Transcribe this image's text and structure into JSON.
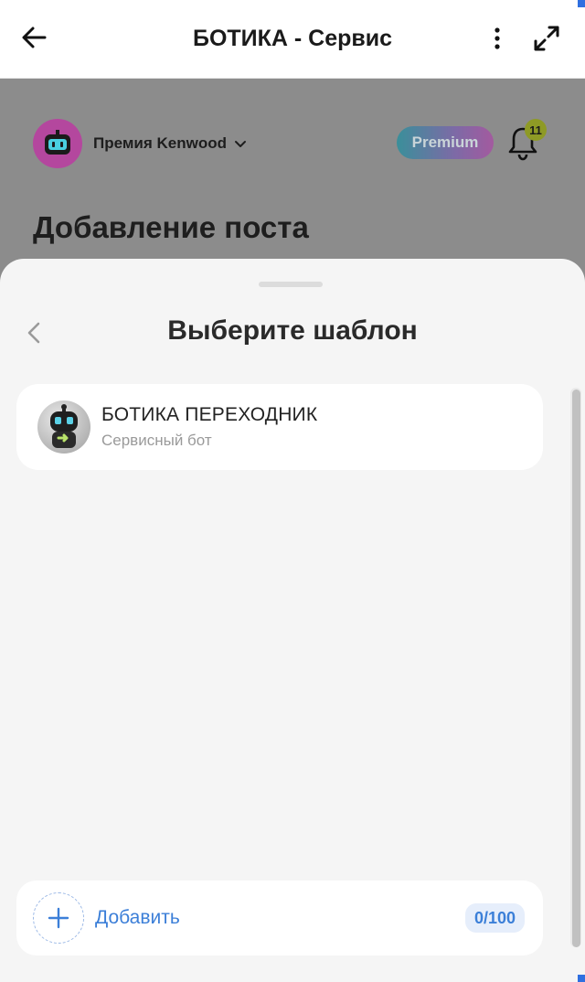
{
  "topbar": {
    "title": "БОТИКА - Сервис",
    "back_icon": "arrow-left-icon",
    "more_icon": "more-vertical-icon",
    "expand_icon": "expand-icon"
  },
  "background_screen": {
    "account_name": "Премия Kenwood",
    "premium_label": "Premium",
    "notifications_count": "11",
    "page_heading": "Добавление поста"
  },
  "sheet": {
    "title": "Выберите шаблон",
    "templates": [
      {
        "name": "БОТИКА ПЕРЕХОДНИК",
        "subtitle": "Сервисный бот"
      }
    ],
    "add_label": "Добавить",
    "counter": "0/100"
  },
  "colors": {
    "accent_blue": "#3c7fd8",
    "premium_gradient_start": "#3a8f9a",
    "premium_gradient_end": "#a35a9f",
    "badge": "#8e9a25"
  }
}
